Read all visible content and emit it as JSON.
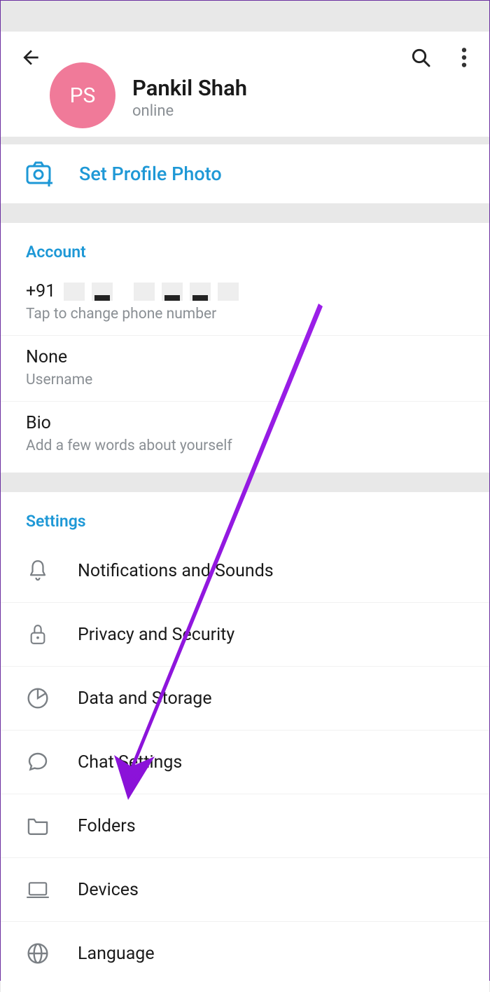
{
  "header": {
    "avatar_initials": "PS",
    "display_name": "Pankil Shah",
    "status": "online"
  },
  "profile_photo": {
    "label": "Set Profile Photo"
  },
  "account": {
    "section_title": "Account",
    "phone_prefix": "+91",
    "phone_hint": "Tap to change phone number",
    "username_value": "None",
    "username_hint": "Username",
    "bio_value": "Bio",
    "bio_hint": "Add a few words about yourself"
  },
  "settings": {
    "section_title": "Settings",
    "items": [
      {
        "label": "Notifications and Sounds"
      },
      {
        "label": "Privacy and Security"
      },
      {
        "label": "Data and Storage"
      },
      {
        "label": "Chat Settings"
      },
      {
        "label": "Folders"
      },
      {
        "label": "Devices"
      },
      {
        "label": "Language"
      }
    ]
  }
}
